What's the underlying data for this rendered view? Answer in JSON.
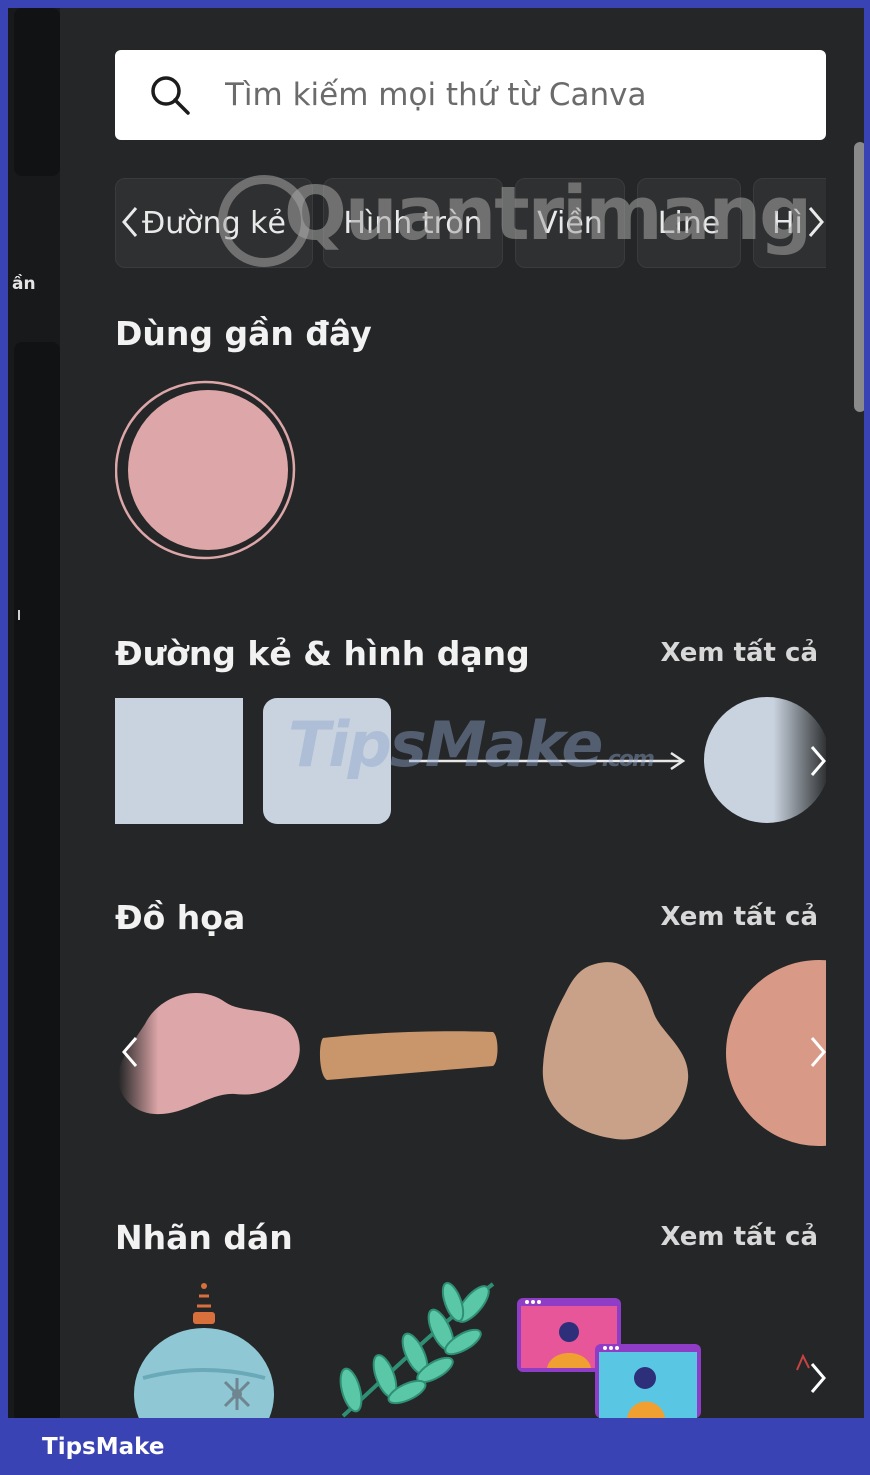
{
  "search": {
    "placeholder": "Tìm kiếm mọi thứ từ Canva"
  },
  "left_nav": {
    "partial_label": "ần"
  },
  "chips": [
    "Đường kẻ",
    "Hình tròn",
    "Viền",
    "Line",
    "Hì"
  ],
  "watermarks": {
    "top": "Quantrimang",
    "middle": "TipsMake",
    "middle_suffix": ".com"
  },
  "sections": {
    "recent": {
      "title": "Dùng gần đây"
    },
    "lines_shapes": {
      "title": "Đường kẻ & hình dạng",
      "see_all": "Xem tất cả"
    },
    "graphics": {
      "title": "Đồ họa",
      "see_all": "Xem tất cả"
    },
    "stickers": {
      "title": "Nhãn dán",
      "see_all": "Xem tất cả"
    }
  },
  "footer": {
    "brand": "TipsMake"
  },
  "colors": {
    "panel": "#252627",
    "pink": "#dda6a8",
    "shape_gray": "#c9d3df",
    "tan": "#c9956a",
    "beige": "#c8a188",
    "salmon": "#d89a86",
    "footer": "#3a43b4"
  }
}
